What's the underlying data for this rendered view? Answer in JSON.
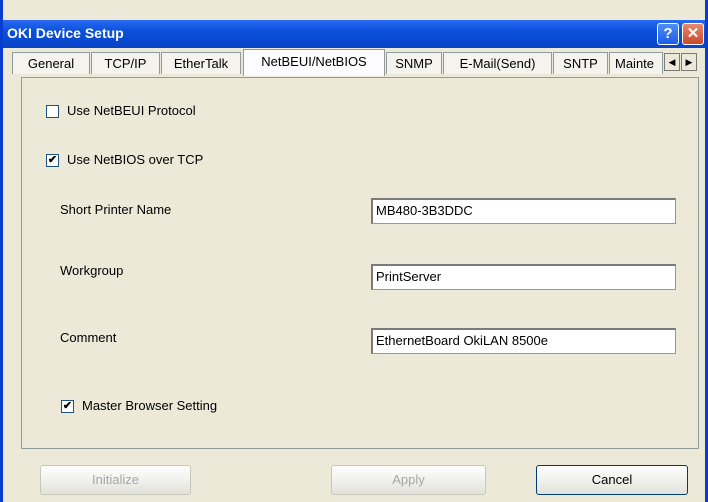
{
  "window": {
    "title": "OKI Device Setup",
    "help_icon": "?",
    "close_icon": "✕"
  },
  "tabs": [
    {
      "label": "General"
    },
    {
      "label": "TCP/IP"
    },
    {
      "label": "EtherTalk"
    },
    {
      "label": "NetBEUI/NetBIOS"
    },
    {
      "label": "SNMP"
    },
    {
      "label": "E-Mail(Send)"
    },
    {
      "label": "SNTP"
    },
    {
      "label": "Mainte"
    }
  ],
  "active_tab": "NetBEUI/NetBIOS",
  "tab_scroll": {
    "left": "◀",
    "right": "▶"
  },
  "options": {
    "netbeui": {
      "label": "Use NetBEUI Protocol",
      "checked": false
    },
    "netbios": {
      "label": "Use NetBIOS over TCP",
      "checked": true
    }
  },
  "fields": {
    "short_name": {
      "label": "Short Printer Name",
      "value": "MB480-3B3DDC"
    },
    "workgroup": {
      "label": "Workgroup",
      "value": "PrintServer"
    },
    "comment": {
      "label": "Comment",
      "value": "EthernetBoard OkiLAN 8500e"
    }
  },
  "master_browser": {
    "label": "Master Browser Setting",
    "checked": true
  },
  "buttons": {
    "initialize": "Initialize",
    "apply": "Apply",
    "cancel": "Cancel"
  },
  "checkmark": "✔"
}
